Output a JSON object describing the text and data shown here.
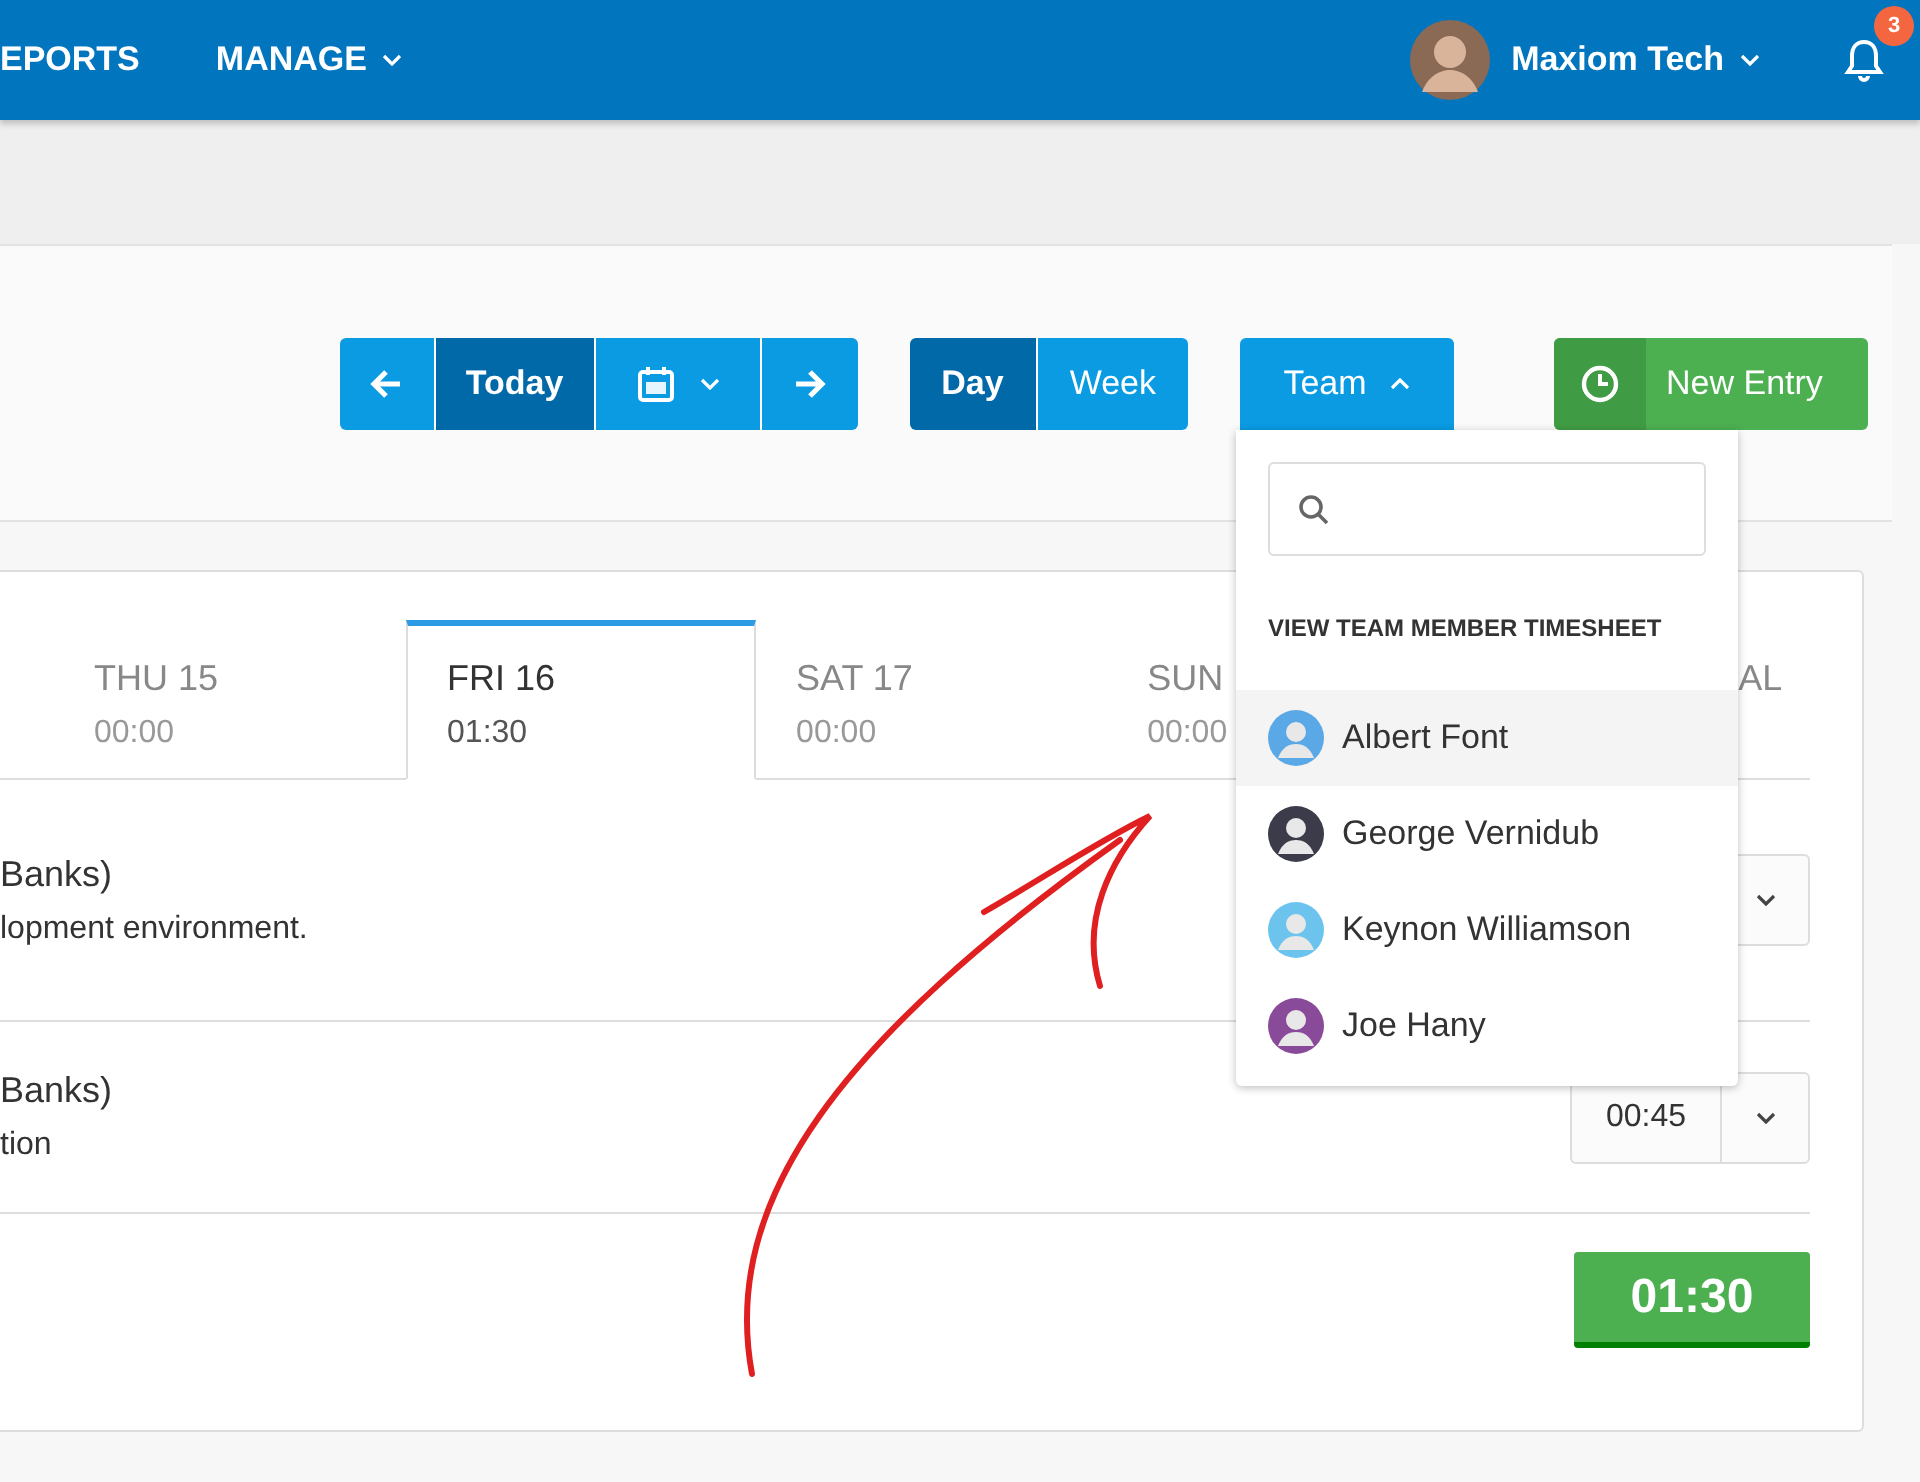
{
  "nav": [
    {
      "label": "EPORTS",
      "has_caret": false
    },
    {
      "label": "MANAGE",
      "has_caret": true
    }
  ],
  "user": {
    "name": "Maxiom Tech"
  },
  "notifications": {
    "count": "3"
  },
  "toolbar": {
    "today": "Today",
    "views": [
      {
        "label": "Day",
        "selected": true
      },
      {
        "label": "Week",
        "selected": false
      }
    ],
    "team": {
      "label": "Team",
      "expanded": true
    },
    "new_entry": "New Entry"
  },
  "days": [
    {
      "label": "THU 15",
      "time": "00:00",
      "selected": false
    },
    {
      "label": "FRI 16",
      "time": "01:30",
      "selected": true
    },
    {
      "label": "SAT 17",
      "time": "00:00",
      "selected": false
    },
    {
      "label": "SUN",
      "time": "00:00",
      "selected": false
    },
    {
      "label": "AL",
      "selected": false
    }
  ],
  "entries": [
    {
      "title": "Banks)",
      "description": "lopment environment."
    },
    {
      "title": "Banks)",
      "description": "tion",
      "time": "00:45"
    }
  ],
  "total": "01:30",
  "team_menu": {
    "heading": "VIEW TEAM MEMBER TIMESHEET",
    "members": [
      {
        "name": "Albert Font",
        "selected": true
      },
      {
        "name": "George Vernidub",
        "selected": false
      },
      {
        "name": "Keynon Williamson",
        "selected": false
      },
      {
        "name": "Joe Hany",
        "selected": false
      }
    ]
  }
}
